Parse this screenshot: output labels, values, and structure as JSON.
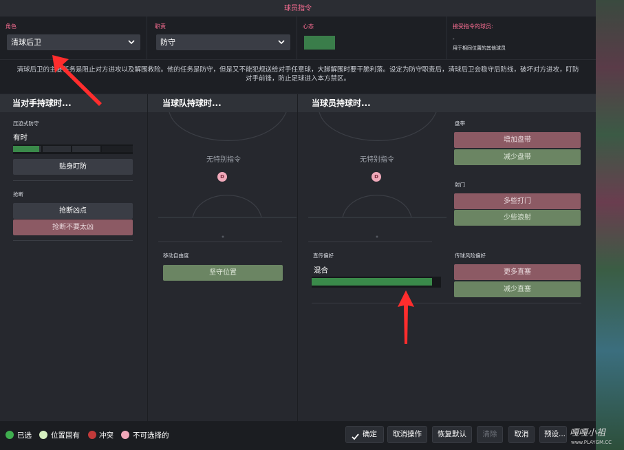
{
  "window": {
    "title": "球员指令"
  },
  "header": {
    "role": {
      "label": "角色",
      "value": "清球后卫"
    },
    "duty": {
      "label": "职责",
      "value": "防守"
    },
    "mood": {
      "label": "心态",
      "color": "#3a7d4a"
    },
    "receiver": {
      "label": "接受指令的球员:",
      "line1": "-",
      "line2": "用于相同位置的其他球员"
    }
  },
  "description": "清球后卫的主要任务是阻止对方进攻以及解围救险。他的任务是防守，但是又不能犯规送给对手任意球，大脚解围时要干脆利落。设定为防守职责后，清球后卫会稳守后防线，破坏对方进攻，盯防对手前锋，防止足球进入本方禁区。",
  "panel_opponent": {
    "title": "当对手持球时...",
    "pressing": {
      "label": "压迫式防守",
      "value": "有时",
      "level": 0.22,
      "mark_button": "贴身盯防"
    },
    "tackling": {
      "label": "抢断",
      "button_hard": "抢断凶点",
      "button_soft": "抢断不要太凶"
    }
  },
  "panel_team": {
    "title": "当球队持球时...",
    "pitch_text": "无特别指令",
    "marker": "D",
    "freedom": {
      "label": "移动自由度",
      "button": "坚守位置"
    }
  },
  "panel_player": {
    "title": "当球员持球时...",
    "pitch_text": "无特别指令",
    "marker": "D",
    "dribble": {
      "label": "盘带",
      "more": "增加盘带",
      "less": "减少盘带"
    },
    "shoot": {
      "label": "射门",
      "more": "多些打门",
      "less": "少些浪射"
    },
    "passing_directness": {
      "label": "直传偏好",
      "value": "混合",
      "level": 0.93
    },
    "passing_risk": {
      "label": "传球风险偏好",
      "more": "更多直塞",
      "less": "减少直塞"
    }
  },
  "legend": [
    {
      "label": "已选",
      "color": "#3fae4f"
    },
    {
      "label": "位置固有",
      "color": "#d6f0c0"
    },
    {
      "label": "冲突",
      "color": "#c23a3a"
    },
    {
      "label": "不可选择的",
      "color": "#f0a9ba"
    }
  ],
  "buttons": {
    "confirm": "确定",
    "undo": "取消操作",
    "reset": "恢复默认",
    "clear": "清除",
    "cancel": "取消",
    "preset": "预设..."
  },
  "watermark": "嘎嘎小祖 www.PLAYGM.CC"
}
